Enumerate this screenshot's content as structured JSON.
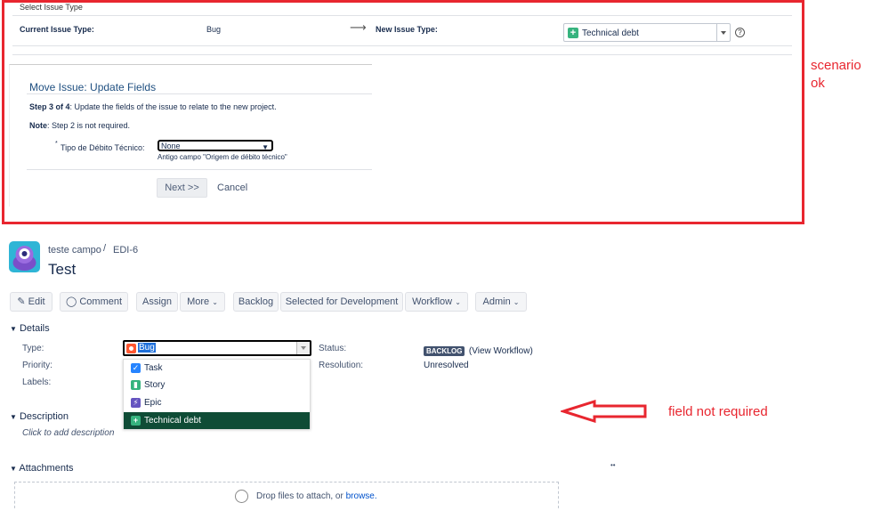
{
  "select_issue": {
    "heading": "Select Issue Type",
    "current_label": "Current Issue Type:",
    "current_value": "Bug",
    "arrow": "⟶",
    "new_label": "New Issue Type:",
    "new_value": "Technical debt",
    "dropdown_icon": "chevron-down-icon",
    "help_icon": "?"
  },
  "move_issue": {
    "title": "Move Issue: Update Fields",
    "step_bold": "Step 3 of 4",
    "step_text": ": Update the fields of the issue to relate to the new project.",
    "note_bold": "Note",
    "note_text": ": Step 2 is not required.",
    "field_required_marker": "*",
    "field_label": "Tipo de Débito Técnico:",
    "field_value": "None",
    "field_hint": "Antigo campo \"Origem de débito técnico\"",
    "next_button": "Next >>",
    "cancel_link": "Cancel"
  },
  "annotations": {
    "top_note_line1": "scenario",
    "top_note_line2": "ok",
    "bottom_note": "field not required",
    "color": "#e8262f"
  },
  "issue": {
    "project": "teste campo",
    "separator": "/",
    "key": "EDI-6",
    "title": "Test"
  },
  "toolbar": {
    "edit": "Edit",
    "comment": "Comment",
    "assign": "Assign",
    "more": "More",
    "backlog": "Backlog",
    "selected_for_dev": "Selected for Development",
    "workflow": "Workflow",
    "admin": "Admin"
  },
  "details": {
    "section": "Details",
    "type_label": "Type:",
    "type_value": "Bug",
    "priority_label": "Priority:",
    "labels_label": "Labels:",
    "status_label": "Status:",
    "status_badge": "BACKLOG",
    "status_link": "(View Workflow)",
    "resolution_label": "Resolution:",
    "resolution_value": "Unresolved"
  },
  "type_dropdown": {
    "options": [
      {
        "label": "Task",
        "color": "#2684ff",
        "icon": "task-checkbox-icon"
      },
      {
        "label": "Story",
        "color": "#36b37e",
        "icon": "story-bookmark-icon"
      },
      {
        "label": "Epic",
        "color": "#6554c0",
        "icon": "epic-bolt-icon"
      },
      {
        "label": "Technical debt",
        "color": "#36b37e",
        "icon": "plus-icon",
        "selected": true
      }
    ]
  },
  "description": {
    "section": "Description",
    "placeholder": "Click to add description"
  },
  "attachments": {
    "section": "Attachments",
    "dots": "••",
    "drop_text": "Drop files to attach, or",
    "browse": "browse."
  }
}
